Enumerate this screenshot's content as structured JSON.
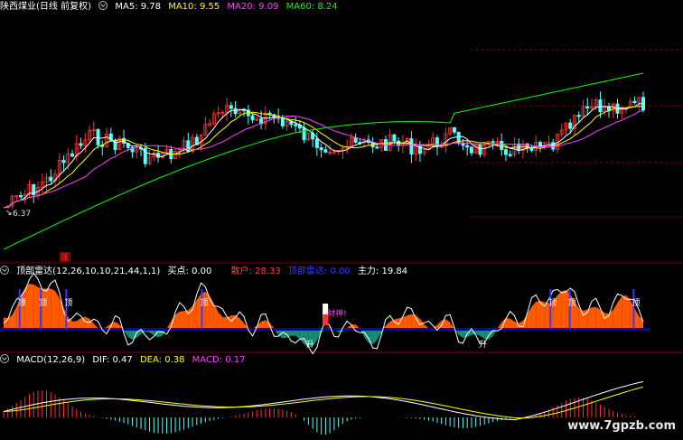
{
  "colors": {
    "up": "#ff3030",
    "down": "#54ffff",
    "ma5": "#ffffff",
    "ma10": "#ffff00",
    "ma20": "#ff40ff",
    "ma60": "#00ff00",
    "sep": "#7a0000",
    "orange": "#ff5a00",
    "teal": "#1a8a78",
    "navy": "#0000c8",
    "buy": "#ffffff",
    "sell": "#ff4040",
    "radar": "#3838ff",
    "main": "#ffffff"
  },
  "main_panel": {
    "title": "陕西煤业(日线 前复权)",
    "ma5": {
      "label": "MA5:",
      "value": "9.78"
    },
    "ma10": {
      "label": "MA10:",
      "value": "9.55"
    },
    "ma20": {
      "label": "MA20:",
      "value": "9.09"
    },
    "ma60": {
      "label": "MA60:",
      "value": "8.24"
    },
    "low_label": "6.37",
    "marker_zhang": "涨"
  },
  "indicator_panel": {
    "title": "顶部雷达(12,26,10,10,21,44,1,1)",
    "buy": {
      "label": "买点:",
      "value": "0.00"
    },
    "sell": {
      "label": "散户:",
      "value": "28.33"
    },
    "radar": {
      "label": "顶部雷达:",
      "value": "0.00"
    },
    "main": {
      "label": "主力:",
      "value": "19.84"
    },
    "peaks": [
      {
        "label": "顶",
        "pos": 0.025
      },
      {
        "label": "顶",
        "pos": 0.058
      },
      {
        "label": "顶",
        "pos": 0.098
      },
      {
        "label": "顶",
        "pos": 0.31
      },
      {
        "label": "顶",
        "pos": 0.855
      },
      {
        "label": "顶",
        "pos": 0.885
      },
      {
        "label": "顶",
        "pos": 0.985
      }
    ],
    "troughs": [
      {
        "label": "升",
        "pos": 0.48
      },
      {
        "label": "升",
        "pos": 0.75
      }
    ],
    "special_label": "财神!",
    "special_pos": 0.503
  },
  "macd_panel": {
    "title": "MACD(12,26,9)",
    "dif": {
      "label": "DIF:",
      "value": "0.47"
    },
    "dea": {
      "label": "DEA:",
      "value": "0.38"
    },
    "macd": {
      "label": "MACD:",
      "value": "0.17"
    }
  },
  "watermark": "www.7gpzb.com",
  "icons": {
    "panel_toggle": "collapse-circle-icon"
  }
}
